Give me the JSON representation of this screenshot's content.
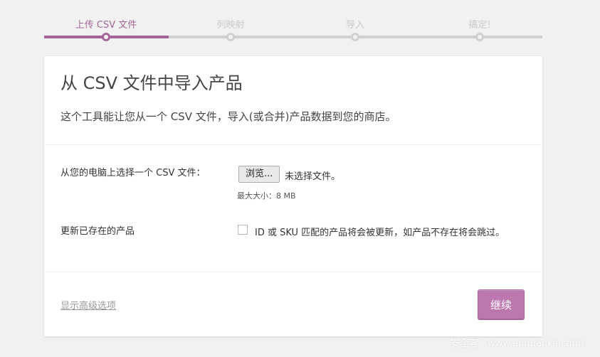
{
  "steps": [
    {
      "label": "上传 CSV 文件",
      "state": "active"
    },
    {
      "label": "列映射",
      "state": "pending"
    },
    {
      "label": "导入",
      "state": "pending"
    },
    {
      "label": "搞定!",
      "state": "pending"
    }
  ],
  "card": {
    "title": "从 CSV 文件中导入产品",
    "description": "这个工具能让您从一个 CSV 文件，导入(或合并)产品数据到您的商店。",
    "file_label": "从您的电脑上选择一个 CSV 文件：",
    "browse_button": "浏览...",
    "no_file_text": "未选择文件。",
    "max_size": "最大大小：8 MB",
    "update_label": "更新已存在的产品",
    "update_checkbox_text": "ID 或 SKU 匹配的产品将会被更新，如产品不存在将会跳过。",
    "update_checked": false,
    "advanced_link": "显示高级选项",
    "continue_button": "继续"
  },
  "watermark": "安全客（www.anquanke.com）",
  "colors": {
    "accent": "#a46497",
    "button": "#bb77ae",
    "track": "#cfcfcf",
    "background": "#f1f1f1"
  }
}
